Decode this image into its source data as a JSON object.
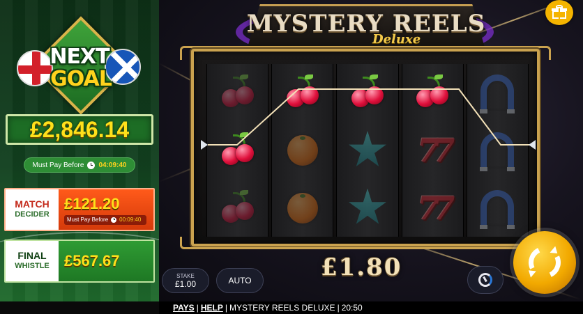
{
  "jackpots": {
    "next_goal": {
      "logo_top": "NEXT",
      "logo_bottom": "GOAL",
      "amount": "£2,846.14",
      "must_pay_label": "Must Pay Before",
      "must_pay_time": "04:09:40"
    },
    "match_decider": {
      "title_line1": "MATCH",
      "title_line2": "DECIDER",
      "amount": "£121.20",
      "must_pay_label": "Must Pay Before",
      "must_pay_time": "00:09:40"
    },
    "final_whistle": {
      "title_line1": "FINAL",
      "title_line2": "WHISTLE",
      "amount": "£567.67"
    }
  },
  "game": {
    "title": "MYSTERY REELS",
    "subtitle": "Deluxe",
    "win_amount": "£1.80",
    "reels": [
      [
        "cherry-dim",
        "cherry",
        "cherry-dim"
      ],
      [
        "cherry",
        "orange-dim",
        "orange-dim"
      ],
      [
        "cherry",
        "star-dim",
        "star-dim"
      ],
      [
        "cherry",
        "seven-dim",
        "seven-dim"
      ],
      [
        "horseshoe-dim",
        "horseshoe-dim",
        "horseshoe-dim"
      ]
    ],
    "controls": {
      "stake_label": "STAKE",
      "stake_value": "£1.00",
      "auto_label": "AUTO"
    }
  },
  "bottom_bar": {
    "pays": "PAYS",
    "separator": "|",
    "help": "HELP",
    "game_name": "MYSTERY REELS DELUXE",
    "clock": "20:50"
  },
  "colors": {
    "gold": "#caa24f",
    "jackpot_yellow": "#ffe01b",
    "spin_orange": "#f2a900"
  }
}
